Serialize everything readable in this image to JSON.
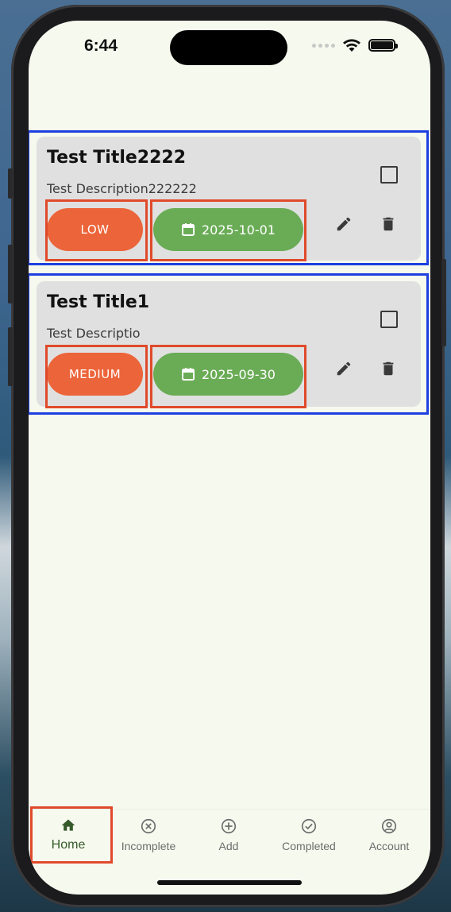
{
  "status_bar": {
    "time": "6:44"
  },
  "tasks": [
    {
      "title": "Test Title2222",
      "description": "Test Description222222",
      "priority": "LOW",
      "due_date": "2025-10-01",
      "completed": false
    },
    {
      "title": "Test Title1",
      "description": "Test Descriptio",
      "priority": "MEDIUM",
      "due_date": "2025-09-30",
      "completed": false
    }
  ],
  "bottom_nav": {
    "items": [
      {
        "label": "Home",
        "icon": "home-icon",
        "active": true
      },
      {
        "label": "Incomplete",
        "icon": "x-circle-icon",
        "active": false
      },
      {
        "label": "Add",
        "icon": "plus-circle-icon",
        "active": false
      },
      {
        "label": "Completed",
        "icon": "check-circle-icon",
        "active": false
      },
      {
        "label": "Account",
        "icon": "account-circle-icon",
        "active": false
      }
    ]
  },
  "colors": {
    "background": "#f6f9ee",
    "card": "#e0e0e0",
    "priority_pill": "#ec6439",
    "date_pill": "#6aac56",
    "active_nav": "#355a2a"
  }
}
